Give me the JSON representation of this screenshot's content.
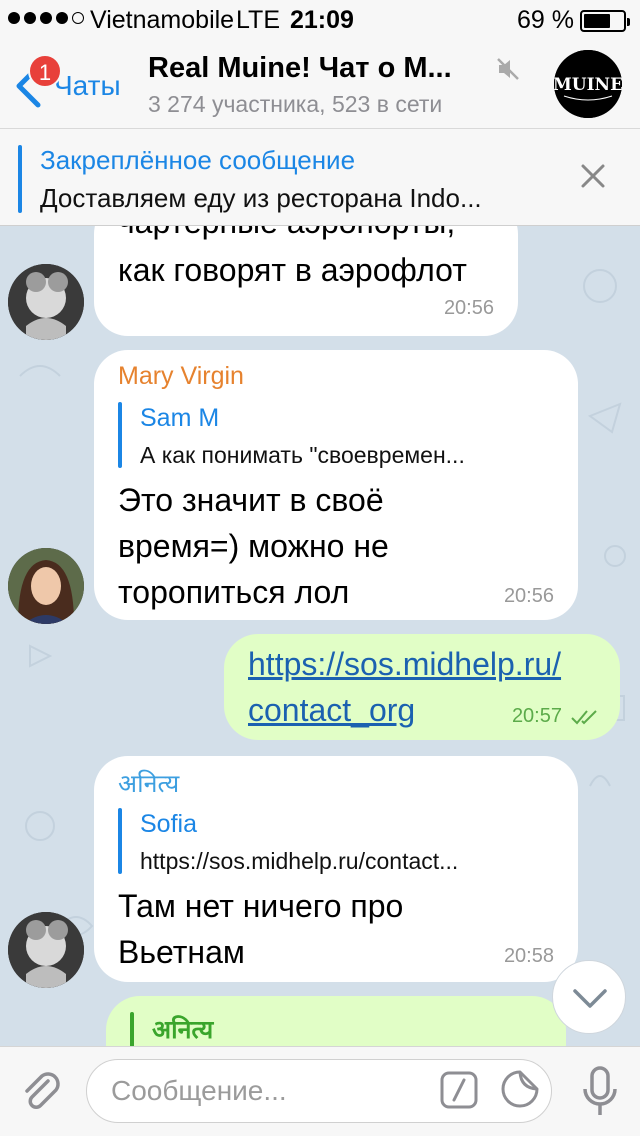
{
  "status_bar": {
    "carrier": "Vietnamobile",
    "network": "LTE",
    "time": "21:09",
    "battery_percent": "69 %",
    "battery_level": 0.69,
    "signal_bars": 4
  },
  "nav": {
    "back_label": "Чаты",
    "unread_count": "1",
    "title": "Real Muine! Чат о М...",
    "subtitle": "3 274 участника, 523 в сети",
    "avatar_text": "MUINE"
  },
  "pinned": {
    "title": "Закреплённое сообщение",
    "text": "Доставляем еду из ресторана Indo..."
  },
  "messages": [
    {
      "lines": [
        "чартерные аэропорты,",
        "как говорят в аэрофлот"
      ],
      "time": "20:56"
    },
    {
      "sender": "Mary Virgin",
      "reply": {
        "name": "Sam M",
        "text": "А как понимать \"своевремен..."
      },
      "lines": [
        "Это значит в своё",
        "время=) можно не",
        "торопиться лол"
      ],
      "time": "20:56"
    },
    {
      "outgoing": true,
      "lines": [
        "https://sos.midhelp.ru/",
        "contact_org"
      ],
      "time": "20:57"
    },
    {
      "sender": "अनित्य",
      "reply": {
        "name": "Sofia",
        "text": "https://sos.midhelp.ru/contact..."
      },
      "lines": [
        "Там нет ничего про",
        "Вьетнам"
      ],
      "time": "20:58"
    },
    {
      "outgoing": true,
      "reply": {
        "name": "अनित्य"
      }
    }
  ],
  "input": {
    "placeholder": "Сообщение..."
  },
  "colors": {
    "accent": "#1b86e5",
    "sender_mary": "#e6822e",
    "sender_anitya": "#3d9fe0",
    "reply_out_green": "#3aa52c",
    "incoming_bg": "#ffffff",
    "outgoing_bg": "#e1fec6",
    "chat_bg": "#d3dfe9",
    "badge": "#e8403a"
  },
  "icons": {
    "back": "chevron-left-icon",
    "mute": "muted-speaker-icon",
    "close": "close-icon",
    "read": "double-check-icon",
    "scroll": "chevron-down-icon",
    "attach": "paperclip-icon",
    "commands": "slash-command-icon",
    "sticker": "sticker-icon",
    "mic": "microphone-icon"
  }
}
